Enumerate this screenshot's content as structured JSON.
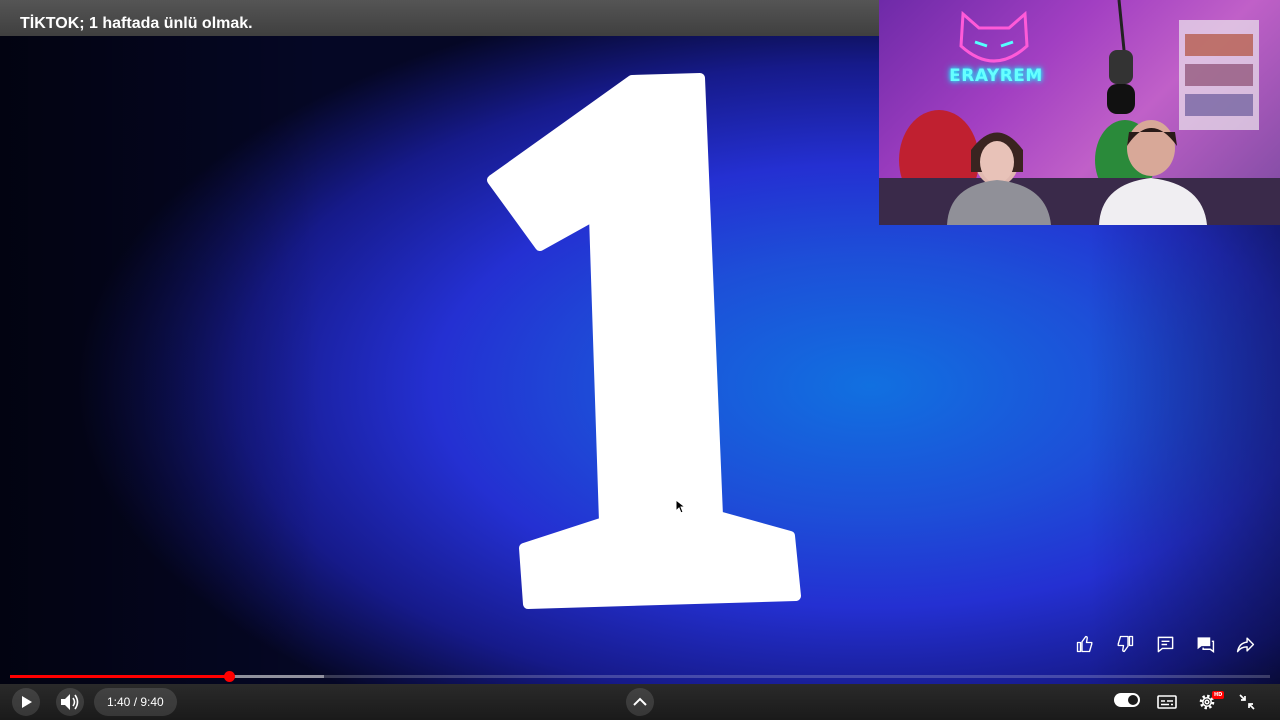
{
  "player": {
    "title": "TİKTOK; 1 haftada ünlü olmak.",
    "time_display": "1:40 / 9:40",
    "progress": {
      "played_fraction": 0.174,
      "buffered_fraction": 0.249
    },
    "accent_color": "#ff0000"
  },
  "video_frame": {
    "number": "1"
  },
  "webcam": {
    "neon_sign": "ERAYREM"
  },
  "actions": [
    "like-icon",
    "dislike-icon",
    "comment-icon",
    "chat-icon",
    "share-icon"
  ],
  "controls": {
    "left": [
      "play-icon",
      "volume-icon"
    ],
    "center": [
      "chevron-up-icon"
    ],
    "right": [
      "autoplay-toggle",
      "subtitles-icon",
      "settings-icon",
      "exit-fullscreen-icon"
    ],
    "hd_badge": "HD"
  }
}
